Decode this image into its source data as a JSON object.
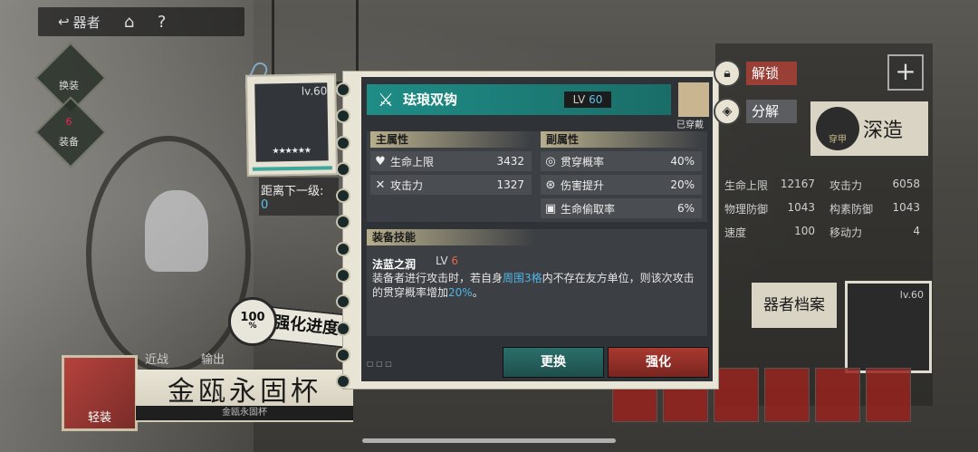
{
  "nav": {
    "back_label": "器者",
    "home_icon": "home-icon",
    "help_icon": "?"
  },
  "side": {
    "swap_label": "换装",
    "heart_count": "6",
    "heart_label": "装备"
  },
  "bottom": {
    "near_label": "近战",
    "out_label": "输出",
    "title": "金瓯永固杯",
    "subtitle": "金瓯永固杯",
    "light_label": "轻装"
  },
  "item_card": {
    "level": "lv.60",
    "stars": "★★★★★★"
  },
  "next_level": {
    "label": "距离下一级:",
    "value": "0"
  },
  "progress": {
    "percent": "100",
    "unit": "%",
    "label": "强化进度"
  },
  "dialog": {
    "name": "珐琅双钩",
    "lv_prefix": "LV",
    "lv_value": "60",
    "equipped_label": "已穿戴",
    "main_header": "主属性",
    "sub_header": "副属性",
    "main_attrs": [
      {
        "name": "生命上限",
        "value": "3432",
        "icon": "heart-icon"
      },
      {
        "name": "攻击力",
        "value": "1327",
        "icon": "swords-icon"
      }
    ],
    "sub_attrs": [
      {
        "name": "贯穿概率",
        "value": "40%",
        "icon": "pierce-icon"
      },
      {
        "name": "伤害提升",
        "value": "20%",
        "icon": "damage-icon"
      },
      {
        "name": "生命偷取率",
        "value": "6%",
        "icon": "lifesteal-icon"
      }
    ],
    "skill_header": "装备技能",
    "skill_name": "法蓝之润",
    "skill_lv_prefix": "LV",
    "skill_lv_value": "6",
    "skill_desc_1": "装备者进行攻击时，若自身",
    "skill_desc_hl1": "周围3格",
    "skill_desc_2": "内不存在友方单位，则该次攻击的贯穿概率增加",
    "skill_desc_hl2": "20%",
    "skill_desc_3": "。",
    "btn_change": "更换",
    "btn_enhance": "强化"
  },
  "actions": {
    "unlock": "解锁",
    "decompose": "分解"
  },
  "right": {
    "deep_label": "深造",
    "deep_sub": "穿甲",
    "archive_label": "器者档案",
    "mini_lv": "lv.60",
    "bg_stats": [
      {
        "name": "生命上限",
        "value": "12167"
      },
      {
        "name": "攻击力",
        "value": "6058"
      },
      {
        "name": "物理防御",
        "value": "1043"
      },
      {
        "name": "构素防御",
        "value": "1043"
      },
      {
        "name": "速度",
        "value": "100"
      },
      {
        "name": "移动力",
        "value": "4"
      }
    ]
  },
  "colors": {
    "teal": "#1f8c86",
    "red": "#a8392f",
    "highlight": "#4fb6e8",
    "lv_red": "#e0664d"
  }
}
